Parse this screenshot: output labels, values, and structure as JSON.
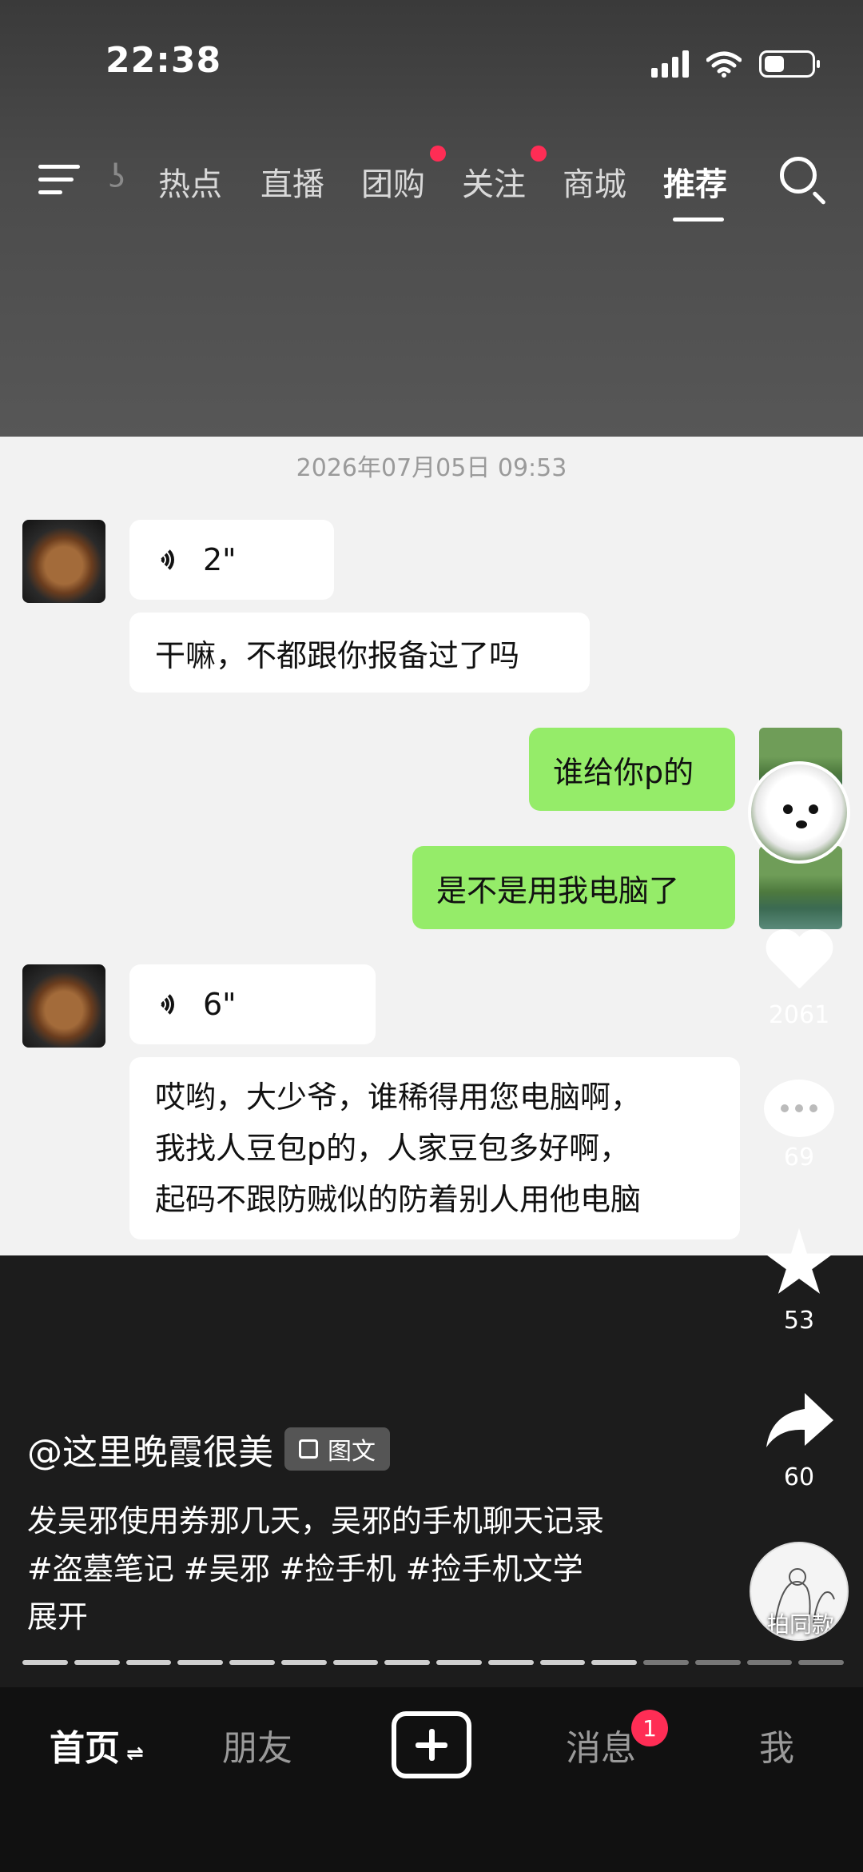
{
  "status_bar": {
    "time": "22:38"
  },
  "nav": {
    "partial_tab": "ʖ",
    "tabs": [
      "热点",
      "直播",
      "团购",
      "关注",
      "商城",
      "推荐"
    ],
    "active_tab": "推荐"
  },
  "chat": {
    "timestamp": "2026年07月05日 09:53",
    "messages": [
      {
        "side": "left",
        "type": "voice",
        "text": "2\""
      },
      {
        "side": "left",
        "type": "text",
        "text": "干嘛，不都跟你报备过了吗"
      },
      {
        "side": "right",
        "type": "text",
        "text": "谁给你p的"
      },
      {
        "side": "right",
        "type": "text",
        "text": "是不是用我电脑了"
      },
      {
        "side": "left",
        "type": "voice",
        "text": "6\""
      },
      {
        "side": "left",
        "type": "text",
        "lines": [
          "哎哟，大少爷，谁稀得用您电脑啊，",
          "我找人豆包p的，人家豆包多好啊，",
          "起码不跟防贼似的防着别人用他电脑"
        ]
      }
    ]
  },
  "actions": {
    "likes": "2061",
    "comments": "69",
    "favorites": "53",
    "shares": "60",
    "same_style_label": "拍同款"
  },
  "post": {
    "author": "@这里晚霞很美",
    "type_badge": "图文",
    "description": "发吴邪使用券那几天，吴邪的手机聊天记录",
    "hashtags": "#盗墓笔记 #吴邪 #捡手机 #捡手机文学",
    "expand": "展开",
    "progress": {
      "total": 16,
      "done": 12
    }
  },
  "bottom_nav": {
    "home": "首页",
    "friends": "朋友",
    "messages": "消息",
    "messages_badge": "1",
    "me": "我"
  }
}
